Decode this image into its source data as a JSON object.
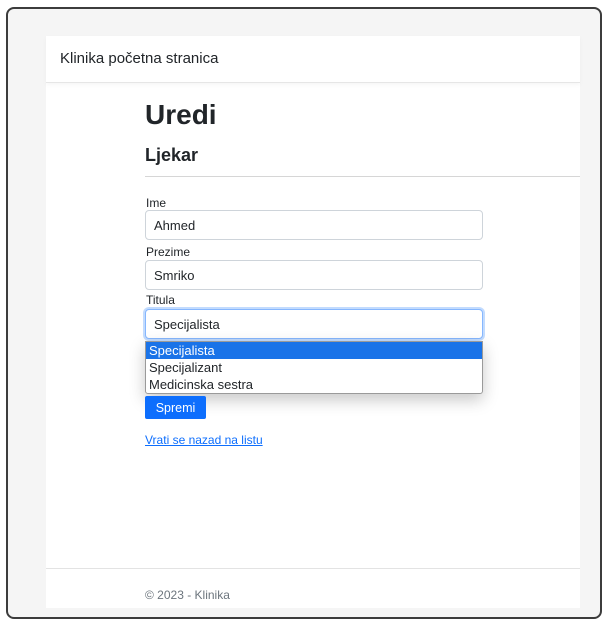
{
  "navbar": {
    "brand": "Klinika početna stranica"
  },
  "heading": {
    "title": "Uredi",
    "subtitle": "Ljekar"
  },
  "form": {
    "first_name": {
      "label": "Ime",
      "value": "Ahmed"
    },
    "last_name": {
      "label": "Prezime",
      "value": "Smriko"
    },
    "title": {
      "label": "Titula",
      "value": "Specijalista",
      "options": [
        "Specijalista",
        "Specijalizant",
        "Medicinska sestra"
      ],
      "selected_index": 0
    },
    "submit_label": "Spremi"
  },
  "back_link": "Vrati se nazad na listu",
  "footer": {
    "text": "© 2023 - Klinika"
  },
  "colors": {
    "primary": "#0d6efd",
    "option_highlight": "#1a73e8",
    "focus_border": "#86b7fe"
  }
}
